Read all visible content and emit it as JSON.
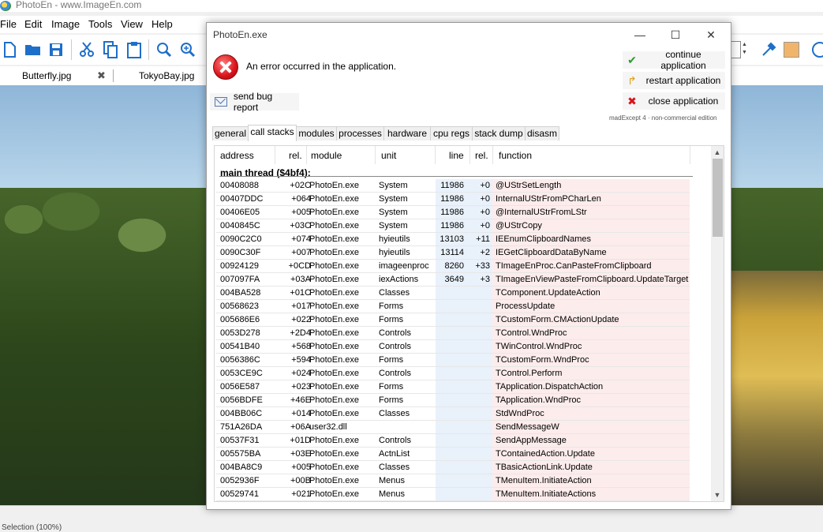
{
  "app": {
    "title": "PhotoEn - www.ImageEn.com",
    "menu": [
      "File",
      "Edit",
      "Image",
      "Tools",
      "View",
      "Help"
    ],
    "doc_tabs": [
      "Butterfly.jpg",
      "TokyoBay.jpg"
    ],
    "close_glyph": "✖",
    "status": "Selection (100%)"
  },
  "dialog": {
    "title": "PhotoEn.exe",
    "window_buttons": [
      "—",
      "☐",
      "✕"
    ],
    "message": "An error occurred in the application.",
    "send_bug_report": "send bug report",
    "continue_application": "continue application",
    "restart_application": "restart application",
    "close_application": "close application",
    "brand_note": "madExcept 4 · non-commercial edition",
    "tabs": [
      "general",
      "call stacks",
      "modules",
      "processes",
      "hardware",
      "cpu regs",
      "stack dump",
      "disasm"
    ],
    "active_tab": "call stacks",
    "columns": [
      "address",
      "rel.",
      "module",
      "unit",
      "line",
      "rel.",
      "function"
    ],
    "thread_label": "main thread ($4bf4):",
    "rows": [
      [
        "00408088",
        "+02C",
        "PhotoEn.exe",
        "System",
        "11986",
        "+0",
        "@UStrSetLength"
      ],
      [
        "00407DDC",
        "+064",
        "PhotoEn.exe",
        "System",
        "11986",
        "+0",
        "InternalUStrFromPCharLen"
      ],
      [
        "00406E05",
        "+005",
        "PhotoEn.exe",
        "System",
        "11986",
        "+0",
        "@InternalUStrFromLStr"
      ],
      [
        "0040845C",
        "+03C",
        "PhotoEn.exe",
        "System",
        "11986",
        "+0",
        "@UStrCopy"
      ],
      [
        "0090C2C0",
        "+074",
        "PhotoEn.exe",
        "hyieutils",
        "13103",
        "+11",
        "IEEnumClipboardNames"
      ],
      [
        "0090C30F",
        "+007",
        "PhotoEn.exe",
        "hyieutils",
        "13114",
        "+2",
        "IEGetClipboardDataByName"
      ],
      [
        "00924129",
        "+0CD",
        "PhotoEn.exe",
        "imageenproc",
        "8260",
        "+33",
        "TImageEnProc.CanPasteFromClipboard"
      ],
      [
        "007097FA",
        "+03A",
        "PhotoEn.exe",
        "iexActions",
        "3649",
        "+3",
        "TImageEnViewPasteFromClipboard.UpdateTarget"
      ],
      [
        "004BA528",
        "+01C",
        "PhotoEn.exe",
        "Classes",
        "",
        "",
        "TComponent.UpdateAction"
      ],
      [
        "00568623",
        "+017",
        "PhotoEn.exe",
        "Forms",
        "",
        "",
        "ProcessUpdate"
      ],
      [
        "005686E6",
        "+022",
        "PhotoEn.exe",
        "Forms",
        "",
        "",
        "TCustomForm.CMActionUpdate"
      ],
      [
        "0053D278",
        "+2D4",
        "PhotoEn.exe",
        "Controls",
        "",
        "",
        "TControl.WndProc"
      ],
      [
        "00541B40",
        "+568",
        "PhotoEn.exe",
        "Controls",
        "",
        "",
        "TWinControl.WndProc"
      ],
      [
        "0056386C",
        "+594",
        "PhotoEn.exe",
        "Forms",
        "",
        "",
        "TCustomForm.WndProc"
      ],
      [
        "0053CE9C",
        "+024",
        "PhotoEn.exe",
        "Controls",
        "",
        "",
        "TControl.Perform"
      ],
      [
        "0056E587",
        "+023",
        "PhotoEn.exe",
        "Forms",
        "",
        "",
        "TApplication.DispatchAction"
      ],
      [
        "0056BDFE",
        "+46E",
        "PhotoEn.exe",
        "Forms",
        "",
        "",
        "TApplication.WndProc"
      ],
      [
        "004BB06C",
        "+014",
        "PhotoEn.exe",
        "Classes",
        "",
        "",
        "StdWndProc"
      ],
      [
        "751A26DA",
        "+06A",
        "user32.dll",
        "",
        "",
        "",
        "SendMessageW"
      ],
      [
        "00537F31",
        "+01D",
        "PhotoEn.exe",
        "Controls",
        "",
        "",
        "SendAppMessage"
      ],
      [
        "005575BA",
        "+03E",
        "PhotoEn.exe",
        "ActnList",
        "",
        "",
        "TContainedAction.Update"
      ],
      [
        "004BA8C9",
        "+005",
        "PhotoEn.exe",
        "Classes",
        "",
        "",
        "TBasicActionLink.Update"
      ],
      [
        "0052936F",
        "+00B",
        "PhotoEn.exe",
        "Menus",
        "",
        "",
        "TMenuItem.InitiateAction"
      ],
      [
        "00529741",
        "+021",
        "PhotoEn.exe",
        "Menus",
        "",
        "",
        "TMenuItem.InitiateActions"
      ]
    ]
  }
}
